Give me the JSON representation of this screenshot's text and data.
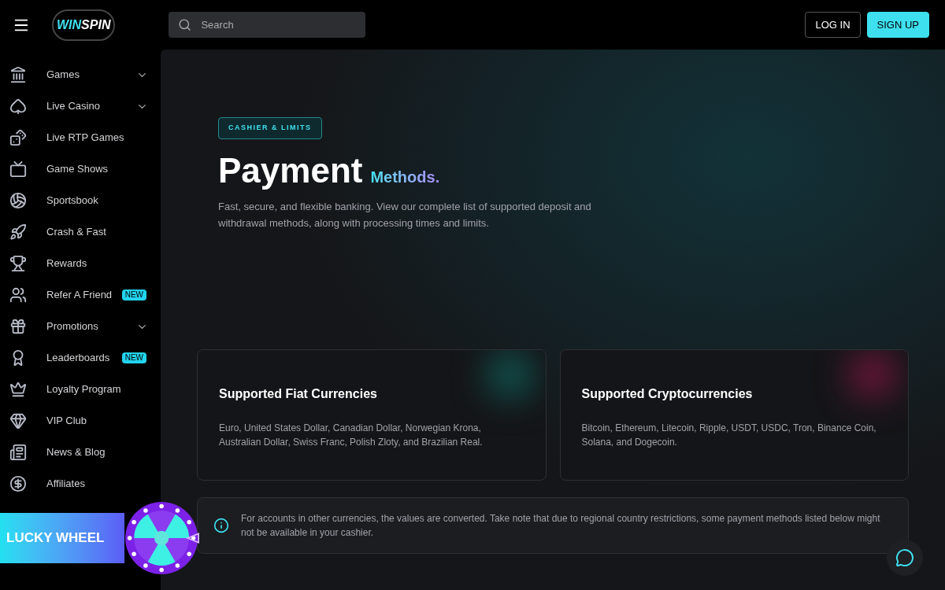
{
  "header": {
    "logo": "WINSPIN",
    "search": {
      "placeholder": "Search"
    },
    "buttons": [
      {
        "label": "LOG IN",
        "kind": "outline"
      },
      {
        "label": "SIGN UP",
        "kind": "filled"
      }
    ]
  },
  "sidebar": {
    "items": [
      {
        "label": "Games",
        "kind": "dropdown"
      },
      {
        "label": "Live Casino",
        "kind": "dropdown"
      },
      {
        "label": "Live RTP Games",
        "kind": "link"
      },
      {
        "label": "Game Shows",
        "kind": "link"
      },
      {
        "label": "Sportsbook",
        "kind": "link"
      },
      {
        "label": "Crash & Fast",
        "kind": "link"
      },
      {
        "label": "Rewards",
        "kind": "link"
      },
      {
        "label": "Refer A Friend",
        "kind": "link",
        "badge": "NEW"
      },
      {
        "label": "Promotions",
        "kind": "dropdown"
      },
      {
        "label": "Leaderboards",
        "kind": "link",
        "badge": "NEW"
      },
      {
        "label": "Loyalty Program",
        "kind": "link"
      },
      {
        "label": "VIP Club",
        "kind": "link"
      },
      {
        "label": "News & Blog",
        "kind": "link"
      },
      {
        "label": "Affiliates",
        "kind": "link"
      }
    ]
  },
  "hero": {
    "tag": "CASHIER & LIMITS",
    "title": "Payment",
    "title_accent": "Methods.",
    "description": "Fast, secure, and flexible banking. View our complete list of supported deposit and withdrawal methods, along with processing times and limits."
  },
  "cards": [
    {
      "title": "Supported Fiat Currencies",
      "text": "Euro, United States Dollar, Canadian Dollar, Norwegian Krona, Australian Dollar, Swiss Franc, Polish Zloty, and Brazilian Real."
    },
    {
      "title": "Supported Cryptocurrencies",
      "text": "Bitcoin, Ethereum, Litecoin, Ripple, USDT, USDC, Tron, Binance Coin, Solana, and Dogecoin."
    }
  ],
  "notice": "For accounts in other currencies, the values are converted. Take note that due to regional country restrictions, some payment methods listed below might not be available in your cashier.",
  "lucky_wheel": {
    "label": "LUCKY WHEEL"
  }
}
